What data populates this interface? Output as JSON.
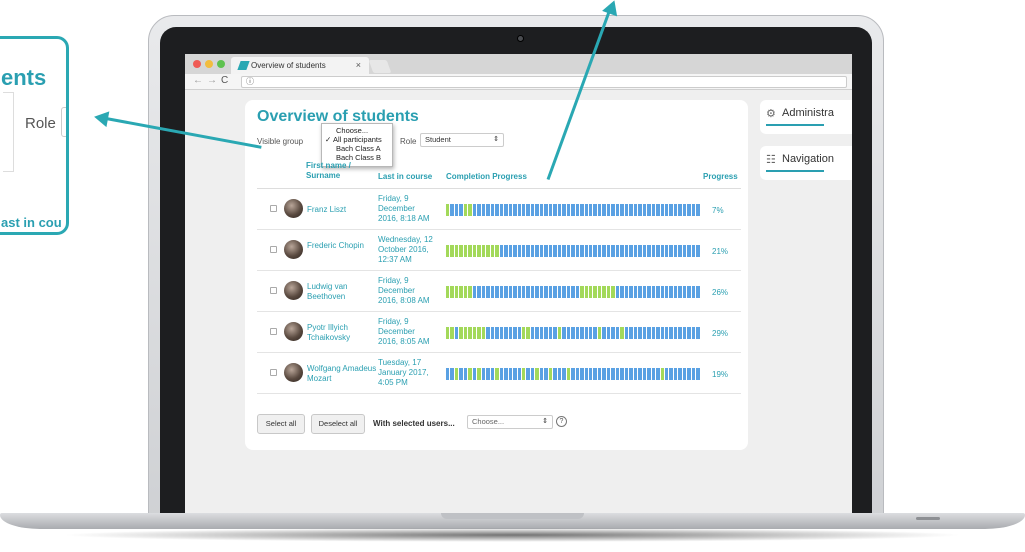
{
  "browser": {
    "tab_title": "Overview of students",
    "tab_close": "×",
    "url_icon": "ⓘ",
    "nav_back": "←",
    "nav_forward": "→",
    "nav_reload": "C"
  },
  "page": {
    "title": "Overview of students",
    "visible_groups_label": "Visible group",
    "group_options": [
      "Choose...",
      "All participants",
      "Bach Class A",
      "Bach Class B"
    ],
    "group_selected_mark": "✓",
    "role_label": "Role",
    "role_value": "Student"
  },
  "table": {
    "headers": {
      "name": "First name / Surname",
      "last_in_course": "Last in course",
      "completion": "Completion Progress",
      "progress": "Progress"
    },
    "rows": [
      {
        "name": "Franz Liszt",
        "last": [
          "Friday, 9",
          "December",
          "2016, 8:18 AM"
        ],
        "progress": "7%",
        "segments": [
          1,
          0,
          0,
          0,
          1,
          1,
          0,
          0,
          0,
          0,
          0,
          0,
          0,
          0,
          0,
          0,
          0,
          0,
          0,
          0,
          0,
          0,
          0,
          0,
          0,
          0,
          0,
          0,
          0,
          0,
          0,
          0,
          0,
          0,
          0,
          0,
          0,
          0,
          0,
          0,
          0,
          0,
          0,
          0,
          0,
          0,
          0,
          0,
          0,
          0,
          0,
          0,
          0,
          0,
          0,
          0,
          0
        ]
      },
      {
        "name": "Frederic Chopin",
        "last": [
          "Wednesday, 12",
          "October 2016,",
          "12:37 AM"
        ],
        "progress": "21%",
        "segments": [
          1,
          1,
          1,
          1,
          1,
          1,
          1,
          1,
          1,
          1,
          1,
          1,
          0,
          0,
          0,
          0,
          0,
          0,
          0,
          0,
          0,
          0,
          0,
          0,
          0,
          0,
          0,
          0,
          0,
          0,
          0,
          0,
          0,
          0,
          0,
          0,
          0,
          0,
          0,
          0,
          0,
          0,
          0,
          0,
          0,
          0,
          0,
          0,
          0,
          0,
          0,
          0,
          0,
          0,
          0,
          0,
          0
        ]
      },
      {
        "name": "Ludwig van Beethoven",
        "last": [
          "Friday, 9",
          "December",
          "2016, 8:08 AM"
        ],
        "progress": "26%",
        "segments": [
          1,
          1,
          1,
          1,
          1,
          1,
          0,
          0,
          0,
          0,
          0,
          0,
          0,
          0,
          0,
          0,
          0,
          0,
          0,
          0,
          0,
          0,
          0,
          0,
          0,
          0,
          0,
          0,
          0,
          0,
          1,
          1,
          1,
          1,
          1,
          1,
          1,
          1,
          0,
          0,
          0,
          0,
          0,
          0,
          0,
          0,
          0,
          0,
          0,
          0,
          0,
          0,
          0,
          0,
          0,
          0,
          0
        ]
      },
      {
        "name": "Pyotr Illyich Tchaikovsky",
        "last": [
          "Friday, 9",
          "December",
          "2016, 8:05 AM"
        ],
        "progress": "29%",
        "segments": [
          1,
          1,
          0,
          1,
          1,
          1,
          1,
          1,
          1,
          0,
          0,
          0,
          0,
          0,
          0,
          0,
          0,
          1,
          1,
          0,
          0,
          0,
          0,
          0,
          0,
          1,
          0,
          0,
          0,
          0,
          0,
          0,
          0,
          0,
          1,
          0,
          0,
          0,
          0,
          1,
          0,
          0,
          0,
          0,
          0,
          0,
          0,
          0,
          0,
          0,
          0,
          0,
          0,
          0,
          0,
          0,
          0
        ]
      },
      {
        "name": "Wolfgang Amadeus Mozart",
        "last": [
          "Tuesday, 17",
          "January 2017,",
          "4:05 PM"
        ],
        "progress": "19%",
        "segments": [
          0,
          0,
          1,
          0,
          0,
          1,
          0,
          1,
          0,
          0,
          0,
          1,
          0,
          0,
          0,
          0,
          0,
          1,
          0,
          0,
          1,
          0,
          0,
          1,
          0,
          0,
          0,
          1,
          0,
          0,
          0,
          0,
          0,
          0,
          0,
          0,
          0,
          0,
          0,
          0,
          0,
          0,
          0,
          0,
          0,
          0,
          0,
          0,
          1,
          0,
          0,
          0,
          0,
          0,
          0,
          0,
          0
        ]
      }
    ]
  },
  "footer": {
    "select_all": "Select all",
    "deselect_all": "Deselect all",
    "with_selected": "With selected users...",
    "choose": "Choose...",
    "help": "?"
  },
  "sidebar": {
    "administration": "Administra",
    "navigation": "Navigation"
  },
  "callout": {
    "title": "ents",
    "role": "Role",
    "column": "ast in cou"
  },
  "colors": {
    "accent": "#2a9fb1",
    "segment_done": "#a3d95a",
    "segment_todo": "#5aa1e3",
    "arrow": "#2aa8b3"
  }
}
